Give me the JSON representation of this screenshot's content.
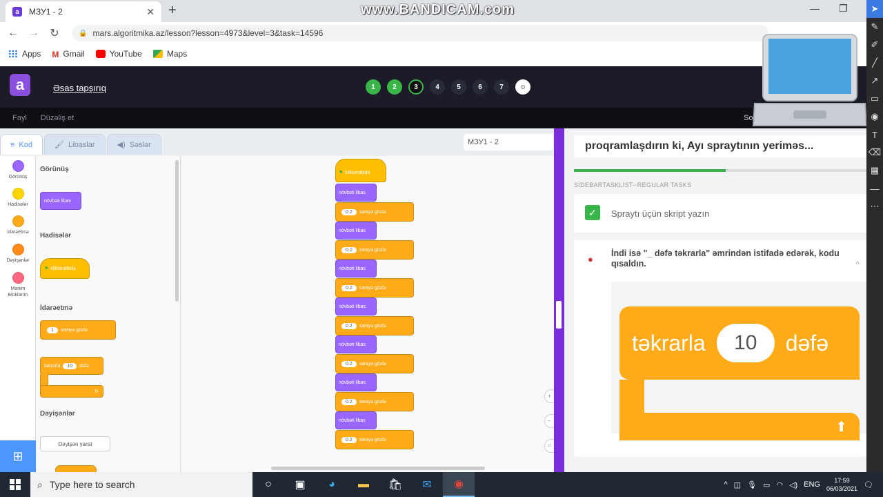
{
  "browser": {
    "tab_title": "МЗУ1 - 2",
    "tab_close": "✕",
    "new_tab": "+",
    "watermark": "www.BANDICAM.com",
    "url": "mars.algoritmika.az/lesson?lesson=4973&level=3&task=14596",
    "bookmarks": [
      "Apps",
      "Gmail",
      "YouTube",
      "Maps"
    ]
  },
  "header": {
    "logo": "a",
    "main_task": "Əsas tapşırıq",
    "steps": [
      {
        "label": "1",
        "state": "done"
      },
      {
        "label": "2",
        "state": "done"
      },
      {
        "label": "3",
        "state": "current"
      },
      {
        "label": "4",
        "state": "todo"
      },
      {
        "label": "5",
        "state": "todo"
      },
      {
        "label": "6",
        "state": "todo"
      },
      {
        "label": "7",
        "state": "todo"
      },
      {
        "label": "☺",
        "state": "smile"
      }
    ],
    "menu": [
      "Fayl",
      "Düzəliş et"
    ],
    "menu_right": "So"
  },
  "editor": {
    "tabs": [
      "Kod",
      "Libaslar",
      "Səslər"
    ],
    "sprite_name": "МЗУ1 - 2",
    "categories": [
      {
        "label": "Görünüş",
        "color": "#9966ff"
      },
      {
        "label": "Hadisələr",
        "color": "#ffd500"
      },
      {
        "label": "İdarəetmə",
        "color": "#ffab19"
      },
      {
        "label": "Dəyişənlər",
        "color": "#ff8c1a"
      },
      {
        "label": "Mənim Bloklarım",
        "color": "#ff6680"
      }
    ],
    "palette": {
      "looks_head": "Görünüş",
      "next_costume": "növbəti libas",
      "events_head": "Hadisələr",
      "when_clicked": "klikləndikdə",
      "control_head": "İdarəetmə",
      "wait_value": "1",
      "wait_label": "saniyə gözlə",
      "repeat_label": "təkrarla",
      "repeat_value": "10",
      "repeat_suffix": "dəfə",
      "variables_head": "Dəyişənlər",
      "make_variable": "Dəyişən yarat"
    },
    "script": {
      "hat": "klikləndikdə",
      "costume": "növbəti libas",
      "wait_value": "0.2",
      "wait_label": "saniyə gözlə"
    }
  },
  "sidebar": {
    "top_text": "proqramlaşdırın ki, Ayı spraytının yeriməs...",
    "progress": 0.52,
    "section_label": "SİDEBARTASKLİST--REGULAR TASKS",
    "task1": "Spraytı üçün skript yazın",
    "task2": "İndi isə \"_ dəfə təkrarla\" əmrindən istifadə edərək, kodu qısaldın.",
    "big_repeat": "təkrarla",
    "big_value": "10",
    "big_suffix": "dəfə"
  },
  "taskbar": {
    "search_placeholder": "Type here to search",
    "lang": "ENG",
    "time": "17:59",
    "date": "06/03/2021"
  }
}
